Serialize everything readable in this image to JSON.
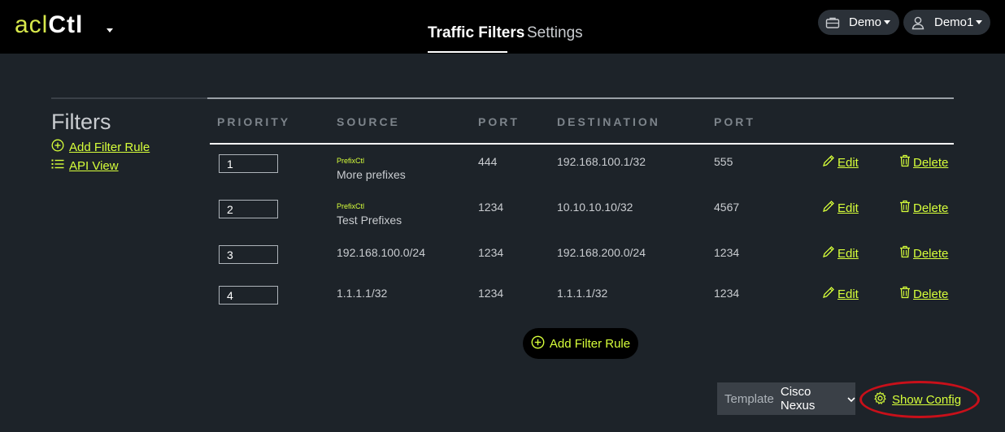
{
  "app": {
    "logo_prefix": "acl",
    "logo_suffix": "Ctl"
  },
  "nav": {
    "tabs": [
      {
        "label": "Traffic Filters",
        "active": true
      },
      {
        "label": "Settings",
        "active": false
      }
    ]
  },
  "header_right": {
    "org_label": "Demo",
    "user_label": "Demo1"
  },
  "sidebar": {
    "title": "Filters",
    "links": [
      {
        "label": "Add Filter Rule",
        "icon": "plus-circle-icon"
      },
      {
        "label": "API View",
        "icon": "list-icon"
      }
    ]
  },
  "table": {
    "headers": [
      "PRIORITY",
      "SOURCE",
      "PORT",
      "DESTINATION",
      "PORT"
    ],
    "rows": [
      {
        "priority": "1",
        "source_tag": "PrefixCtl",
        "source": "More prefixes",
        "src_port": "444",
        "destination": "192.168.100.1/32",
        "dst_port": "555",
        "edit": "Edit",
        "delete": "Delete"
      },
      {
        "priority": "2",
        "source_tag": "PrefixCtl",
        "source": "Test Prefixes",
        "src_port": "1234",
        "destination": "10.10.10.10/32",
        "dst_port": "4567",
        "edit": "Edit",
        "delete": "Delete"
      },
      {
        "priority": "3",
        "source_tag": "",
        "source": "192.168.100.0/24",
        "src_port": "1234",
        "destination": "192.168.200.0/24",
        "dst_port": "1234",
        "edit": "Edit",
        "delete": "Delete"
      },
      {
        "priority": "4",
        "source_tag": "",
        "source": "1.1.1.1/32",
        "src_port": "1234",
        "destination": "1.1.1.1/32",
        "dst_port": "1234",
        "edit": "Edit",
        "delete": "Delete"
      }
    ]
  },
  "actions": {
    "add_filter_rule": "Add Filter Rule"
  },
  "footer": {
    "template_label": "Template",
    "template_value": "Cisco Nexus",
    "show_config": "Show Config"
  },
  "colors": {
    "accent": "#d7ff3a",
    "background": "#1d2329",
    "topbar": "#000000",
    "highlight": "#c8101a"
  }
}
